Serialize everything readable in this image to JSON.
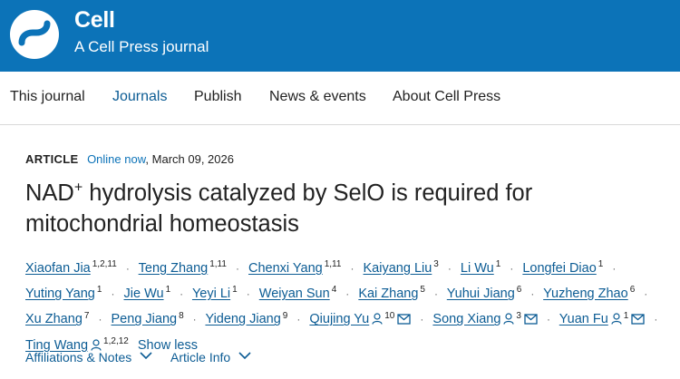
{
  "brand": {
    "name": "Cell",
    "tagline": "A Cell Press journal",
    "color": "#0c73b8"
  },
  "nav": [
    {
      "label": "This journal",
      "active": false
    },
    {
      "label": "Journals",
      "active": true
    },
    {
      "label": "Publish",
      "active": false
    },
    {
      "label": "News & events",
      "active": false
    },
    {
      "label": "About Cell Press",
      "active": false
    }
  ],
  "article": {
    "type": "ARTICLE",
    "status": "Online now",
    "sep": ",",
    "date": "March 09, 2026",
    "title_pre": "NAD",
    "title_sup": "+",
    "title_rest": " hydrolysis catalyzed by SelO is required for mitochondrial homeostasis"
  },
  "authors": [
    {
      "name": "Xiaofan Jia",
      "aff": "1,2,11"
    },
    {
      "name": "Teng Zhang",
      "aff": "1,11"
    },
    {
      "name": "Chenxi Yang",
      "aff": "1,11"
    },
    {
      "name": "Kaiyang Liu",
      "aff": "3"
    },
    {
      "name": "Li Wu",
      "aff": "1"
    },
    {
      "name": "Longfei Diao",
      "aff": "1"
    },
    {
      "name": "Yuting Yang",
      "aff": "1"
    },
    {
      "name": "Jie Wu",
      "aff": "1"
    },
    {
      "name": "Yeyi Li",
      "aff": "1"
    },
    {
      "name": "Weiyan Sun",
      "aff": "4"
    },
    {
      "name": "Kai Zhang",
      "aff": "5"
    },
    {
      "name": "Yuhui Jiang",
      "aff": "6"
    },
    {
      "name": "Yuzheng Zhao",
      "aff": "6"
    },
    {
      "name": "Xu Zhang",
      "aff": "7"
    },
    {
      "name": "Peng Jiang",
      "aff": "8"
    },
    {
      "name": "Yideng Jiang",
      "aff": "9"
    },
    {
      "name": "Qiujing Yu",
      "aff": "10",
      "person": true,
      "mail": true
    },
    {
      "name": "Song Xiang",
      "aff": "3",
      "person": true,
      "mail": true
    },
    {
      "name": "Yuan Fu",
      "aff": "1",
      "person": true,
      "mail": true
    },
    {
      "name": "Ting Wang",
      "aff": "1,2,12",
      "person": true,
      "mail": false
    }
  ],
  "show_less": "Show less",
  "footer": {
    "affiliations": "Affiliations & Notes",
    "article_info": "Article Info"
  },
  "icons": {
    "logo": "cell-press-logo-icon",
    "person": "person-icon",
    "mail": "mail-icon",
    "chevron": "chevron-down-icon"
  }
}
